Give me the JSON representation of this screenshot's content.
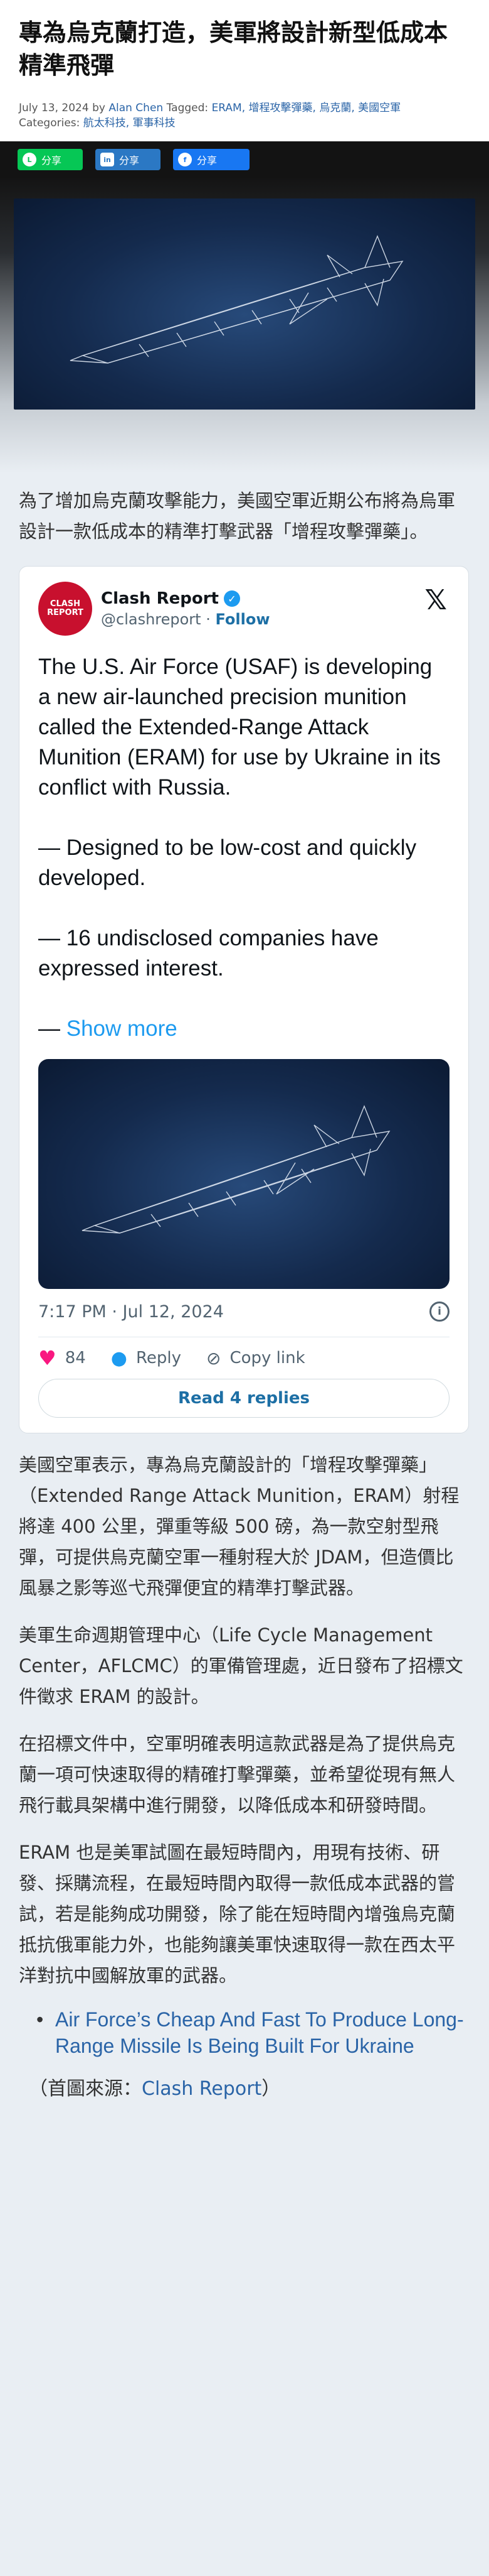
{
  "article": {
    "title": "專為烏克蘭打造，美軍將設計新型低成本精準飛彈",
    "date": "July 13, 2024",
    "by": "by",
    "author": "Alan Chen",
    "tagged_label": "Tagged:",
    "tags": "ERAM, 增程攻擊彈藥, 烏克蘭, 美國空軍",
    "categories_label": "Categories:",
    "categories": "航太科技, 軍事科技"
  },
  "share": {
    "line_label": "分享",
    "linkedin_label": "分享",
    "facebook_label": "分享"
  },
  "paragraphs": {
    "p1": "為了增加烏克蘭攻擊能力，美國空軍近期公布將為烏軍設計一款低成本的精準打擊武器「增程攻擊彈藥」。",
    "p2": "美國空軍表示，專為烏克蘭設計的「增程攻擊彈藥」（Extended Range Attack Munition，ERAM）射程將達 400 公里，彈重等級 500 磅，為一款空射型飛彈，可提供烏克蘭空軍一種射程大於 JDAM，但造價比風暴之影等巡弋飛彈便宜的精準打擊武器。",
    "p3": "美軍生命週期管理中心（Life Cycle Management Center，AFLCMC）的軍備管理處，近日發布了招標文件徵求 ERAM 的設計。",
    "p4": "在招標文件中，空軍明確表明這款武器是為了提供烏克蘭一項可快速取得的精確打擊彈藥，並希望從現有無人飛行載具架構中進行開發，以降低成本和研發時間。",
    "p5": "ERAM 也是美軍試圖在最短時間內，用現有技術、研發、採購流程，在最短時間內取得一款低成本武器的嘗試，若是能夠成功開發，除了能在短時間內增強烏克蘭抵抗俄軍能力外，也能夠讓美軍快速取得一款在西太平洋對抗中國解放軍的武器。"
  },
  "tweet": {
    "avatar_text": "CLASH REPORT",
    "name": "Clash Report",
    "handle": "@clashreport",
    "follow": "Follow",
    "line1": "The U.S. Air Force (USAF) is developing a new air-launched precision munition called the Extended-Range Attack Munition (ERAM) for use by Ukraine in its conflict with Russia.",
    "line2": "— Designed to be low-cost and quickly developed.",
    "line3": "— 16 undisclosed companies have expressed interest.",
    "more_prefix": "— ",
    "more": "Show more",
    "time": "7:17 PM · Jul 12, 2024",
    "likes": "84",
    "reply": "Reply",
    "copy": "Copy link",
    "read_replies": "Read 4 replies"
  },
  "related": {
    "link1": "Air Force’s Cheap And Fast To Produce Long-Range Missile Is Being Built For Ukraine"
  },
  "source": {
    "prefix": "（首圖來源：",
    "link": "Clash Report",
    "suffix": "）"
  }
}
